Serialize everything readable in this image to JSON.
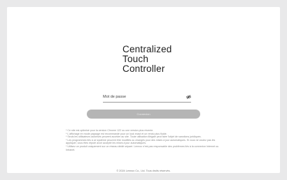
{
  "title": {
    "line1": "Centralized",
    "line2": "Touch",
    "line3": "Controller"
  },
  "login": {
    "password_placeholder": "Mot de passe",
    "password_value": "",
    "toggle_icon": "eye-slash-icon",
    "button_label": "Connexion"
  },
  "notes": [
    "* Ce site est optimisé pour la version Chrome 122 ou une version plus récente.",
    "* L'affichage en mode paysage est recommandé pour un look exact et un rendu plus fluide.",
    "* Seuls les utilisateurs autorisés peuvent accéder au site. Toute utilisation illégale peut faire l'objet de sanctions juridiques.",
    "* Les programmes liés à ce système peuvent être modifiés ou changés pour des mises à jour automatiques. Si vous ne voulez pas les appliquer, vous êtes réputé avoir accepté les mises à jour automatiques.",
    "* Utilisez ce produit uniquement sur un réseau dédié séparé. Lennox n'est pas responsable des problèmes liés à la connexion Internet ou Intranet."
  ],
  "footer": {
    "copyright": "© 2024 Lennox Co., Ltd. Tous droits réservés."
  }
}
